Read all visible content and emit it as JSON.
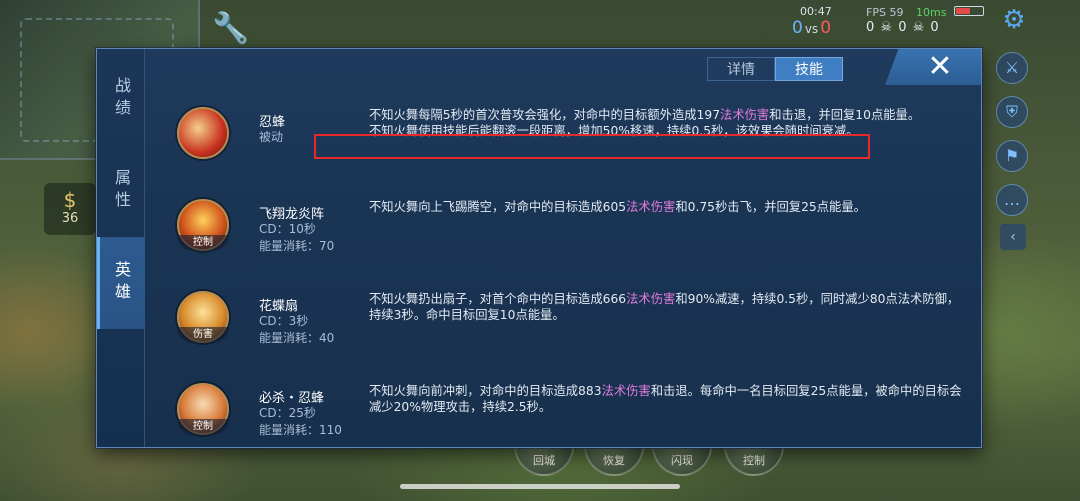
{
  "hud": {
    "clock": "00:47",
    "score_blue": "0",
    "score_vs": "vs",
    "score_red": "0",
    "fps": "FPS 59",
    "wifi": "10ms",
    "kda": "0 ☠ 0 ☠ 0",
    "gold": "36"
  },
  "panel": {
    "side_tabs": [
      "战绩",
      "属性",
      "英雄"
    ],
    "active_side_tab": "英雄",
    "top_tabs": [
      "详情",
      "技能"
    ],
    "active_top_tab": "技能",
    "close_icon": "✕"
  },
  "skills": [
    {
      "name": "忍蜂",
      "meta1": "被动",
      "meta2": "",
      "tag": "",
      "icon_color": "#c9321f",
      "desc_a": "不知火舞每隔5秒的首次普攻会强化，对命中的目标额外造成197",
      "desc_magic": "法术伤害",
      "desc_b": "和击退，并回复10点能量。",
      "desc_line2": "不知火舞使用技能后能翻滚一段距离，增加50%移速，持续0.5秒，该效果会随时间衰减。"
    },
    {
      "name": "飞翔龙炎阵",
      "meta1": "CD：10秒",
      "meta2": "能量消耗：70",
      "tag": "控制",
      "icon_color": "#d0541c",
      "desc_a": "不知火舞向上飞踢腾空，对命中的目标造成605",
      "desc_magic": "法术伤害",
      "desc_b": "和0.75秒击飞，并回复25点能量。",
      "desc_line2": ""
    },
    {
      "name": "花蝶扇",
      "meta1": "CD：3秒",
      "meta2": "能量消耗：40",
      "tag": "伤害",
      "icon_color": "#d8892a",
      "desc_a": "不知火舞扔出扇子，对首个命中的目标造成666",
      "desc_magic": "法术伤害",
      "desc_b": "和90%减速，持续0.5秒，同时减少80点法术防御，持续3秒。命中目标回复10点能量。",
      "desc_line2": ""
    },
    {
      "name": "必杀・忍蜂",
      "meta1": "CD：25秒",
      "meta2": "能量消耗：110",
      "tag": "控制",
      "icon_color": "#d97a3a",
      "desc_a": "不知火舞向前冲刺，对命中的目标造成883",
      "desc_magic": "法术伤害",
      "desc_b": "和击退。每命中一名目标回复25点能量，被命中的目标会减少20%物理攻击，持续2.5秒。",
      "desc_line2": ""
    }
  ],
  "bottom_skills": [
    "回城",
    "恢复",
    "闪现",
    "控制"
  ]
}
